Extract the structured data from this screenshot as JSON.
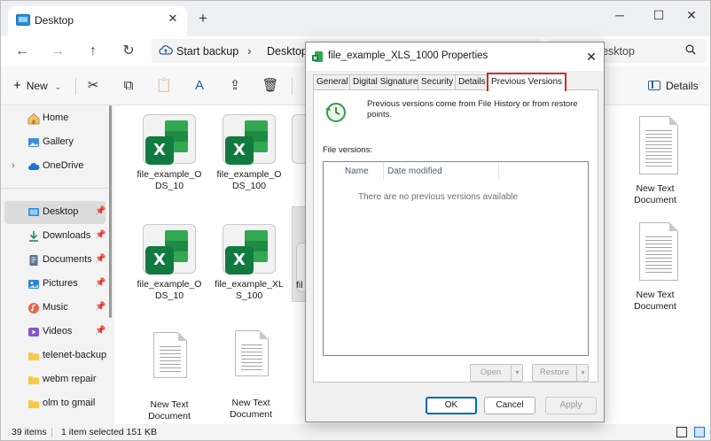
{
  "window": {
    "tab_title": "Desktop",
    "tab_close_glyph": "✕",
    "new_tab_glyph": "+",
    "controls": {
      "minimize": "─",
      "maximize": "☐",
      "close": "✕"
    }
  },
  "address": {
    "back_glyph": "←",
    "forward_glyph": "→",
    "up_glyph": "↑",
    "refresh_glyph": "↻",
    "backup_label": "Start backup",
    "chevron_glyph": "›",
    "location": "Desktop",
    "search_placeholder": "Search Desktop"
  },
  "toolbar": {
    "new_label": "New",
    "new_plus": "+",
    "new_chevron": "⌄",
    "cut_glyph": "✂",
    "copy_glyph": "⧉",
    "paste_glyph": "📋",
    "rename_glyph": "A",
    "share_glyph": "⇪",
    "delete_glyph": "🗑",
    "details_label": "Details"
  },
  "sidebar": {
    "items": [
      {
        "label": "Home",
        "icon": "home-icon",
        "pinned": false,
        "selected": false,
        "expandable": false
      },
      {
        "label": "Gallery",
        "icon": "gallery-icon",
        "pinned": false,
        "selected": false,
        "expandable": false
      },
      {
        "label": "OneDrive",
        "icon": "cloud-icon",
        "pinned": false,
        "selected": false,
        "expandable": true
      },
      {
        "label": "Desktop",
        "icon": "desktop-icon",
        "pinned": true,
        "selected": true,
        "expandable": false
      },
      {
        "label": "Downloads",
        "icon": "download-icon",
        "pinned": true,
        "selected": false,
        "expandable": false
      },
      {
        "label": "Documents",
        "icon": "documents-icon",
        "pinned": true,
        "selected": false,
        "expandable": false
      },
      {
        "label": "Pictures",
        "icon": "pictures-icon",
        "pinned": true,
        "selected": false,
        "expandable": false
      },
      {
        "label": "Music",
        "icon": "music-icon",
        "pinned": true,
        "selected": false,
        "expandable": false
      },
      {
        "label": "Videos",
        "icon": "videos-icon",
        "pinned": true,
        "selected": false,
        "expandable": false
      },
      {
        "label": "telenet-backup",
        "icon": "folder-icon",
        "pinned": false,
        "selected": false,
        "expandable": false
      },
      {
        "label": "webm repair",
        "icon": "folder-icon",
        "pinned": false,
        "selected": false,
        "expandable": false
      },
      {
        "label": "olm to gmail",
        "icon": "folder-icon",
        "pinned": false,
        "selected": false,
        "expandable": false
      }
    ],
    "pin_glyph": "📌",
    "expand_glyph": "›"
  },
  "files": [
    {
      "name": "file_example_ODS_10",
      "type": "excel"
    },
    {
      "name": "file_example_ODS_100",
      "type": "excel"
    },
    {
      "name": "file_example_ODS_10",
      "type": "excel"
    },
    {
      "name": "file_example_XLS_100",
      "type": "excel"
    },
    {
      "name": "fil",
      "type": "excel-partial"
    },
    {
      "name": "New Text Document",
      "type": "text"
    },
    {
      "name": "New Text Document",
      "type": "text"
    },
    {
      "name": "New Text Document",
      "type": "text"
    },
    {
      "name": "New Text Document",
      "type": "text"
    }
  ],
  "excel_badge": "X",
  "status": {
    "items_count": "39 items",
    "selection": "1 item selected  151 KB"
  },
  "dialog": {
    "title": "file_example_XLS_1000 Properties",
    "close_glyph": "✕",
    "tabs": [
      "General",
      "Digital Signatures",
      "Security",
      "Details",
      "Previous Versions"
    ],
    "active_tab": "Previous Versions",
    "description": "Previous versions come from File History or from restore points.",
    "file_versions_label": "File versions:",
    "columns": [
      "Name",
      "Date modified"
    ],
    "empty_message": "There are no previous versions available",
    "open_label": "Open",
    "restore_label": "Restore",
    "dropdown_glyph": "▾",
    "ok_label": "OK",
    "cancel_label": "Cancel",
    "apply_label": "Apply",
    "highlight_color": "#d62828"
  }
}
